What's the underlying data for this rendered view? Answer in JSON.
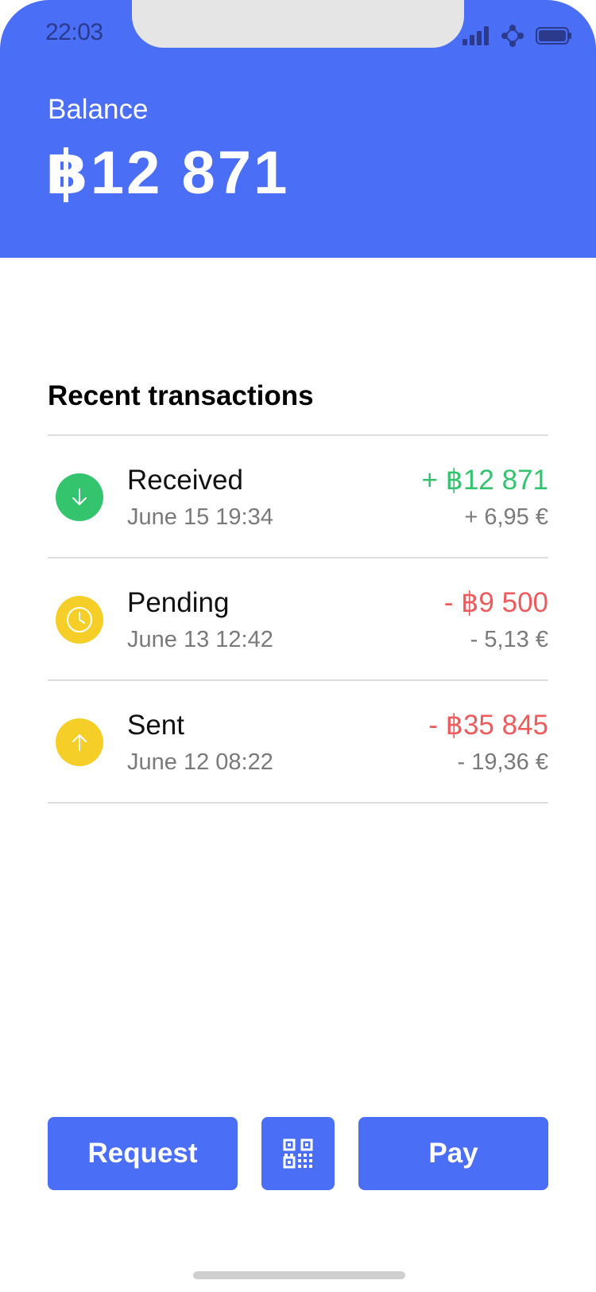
{
  "status_bar": {
    "time": "22:03"
  },
  "balance": {
    "label": "Balance",
    "amount": "฿12 871"
  },
  "section": {
    "title": "Recent transactions"
  },
  "transactions": [
    {
      "title": "Received",
      "date": "June 15 19:34",
      "amount": "+ ฿12 871",
      "fiat": "+ 6,95 €",
      "icon": "arrow-down-icon",
      "badge_color": "#34C46E",
      "amount_color": "#34C46E"
    },
    {
      "title": "Pending",
      "date": "June 13 12:42",
      "amount": "- ฿9 500",
      "fiat": "- 5,13 €",
      "icon": "clock-icon",
      "badge_color": "#F6CE28",
      "amount_color": "#EF5A5A"
    },
    {
      "title": "Sent",
      "date": "June 12 08:22",
      "amount": "- ฿35 845",
      "fiat": "- 19,36 €",
      "icon": "arrow-up-icon",
      "badge_color": "#F6CE28",
      "amount_color": "#EF5A5A"
    }
  ],
  "actions": {
    "request_label": "Request",
    "qr_icon": "qr-code-icon",
    "pay_label": "Pay"
  },
  "colors": {
    "primary": "#4A6EF5",
    "positive": "#34C46E",
    "negative": "#EF5A5A",
    "pending": "#F6CE28"
  }
}
